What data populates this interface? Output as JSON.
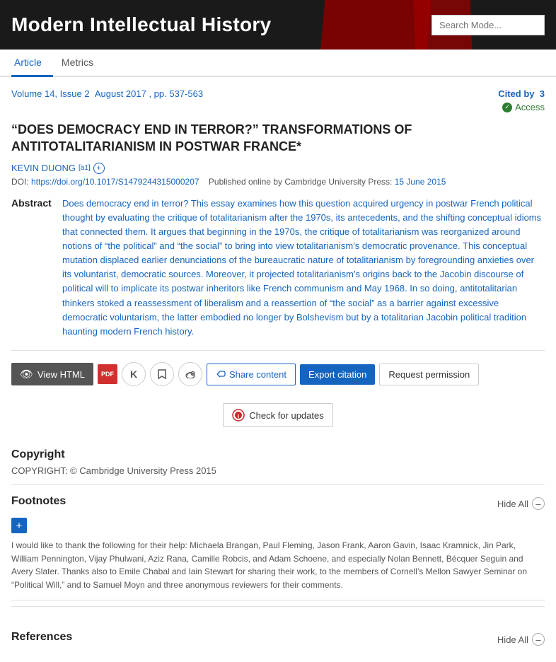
{
  "header": {
    "title": "Modern Intellectual History",
    "search_placeholder": "Search Mode..."
  },
  "tabs": [
    {
      "label": "Article",
      "active": true
    },
    {
      "label": "Metrics",
      "active": false
    }
  ],
  "article": {
    "volume_link": "Volume 14, Issue 2",
    "date_pages": "August 2017 , pp. 537-563",
    "cited_by_label": "Cited by",
    "cited_by_count": "3",
    "access_label": "Access",
    "title": "“DOES DEMOCRACY END IN TERROR?” TRANSFORMATIONS OF ANTITOTALITARIANISM IN POSTWAR FRANCE*",
    "author": "KEVIN DUONG",
    "author_superscript": "[a1]",
    "doi_label": "DOI:",
    "doi_url": "https://doi.org/10.1017/S1479244315000207",
    "published_label": "Published online by Cambridge University Press:",
    "published_date": "15 June 2015",
    "abstract_label": "Abstract",
    "abstract_text": "Does democracy end in terror? This essay examines how this question acquired urgency in postwar French political thought by evaluating the critique of totalitarianism after the 1970s, its antecedents, and the shifting conceptual idioms that connected them. It argues that beginning in the 1970s, the critique of totalitarianism was reorganized around notions of “the political” and “the social” to bring into view totalitarianism’s democratic provenance. This conceptual mutation displaced earlier denunciations of the bureaucratic nature of totalitarianism by foregrounding anxieties over its voluntarist, democratic sources. Moreover, it projected totalitarianism’s origins back to the Jacobin discourse of political will to implicate its postwar inheritors like French communism and May 1968. In so doing, antitotalitarian thinkers stoked a reassessment of liberalism and a reassertion of “the social” as a barrier against excessive democratic voluntarism, the latter embodied no longer by Bolshevism but by a totalitarian Jacobin political tradition haunting modern French history."
  },
  "buttons": {
    "view_html": "View HTML",
    "share": "Share content",
    "export": "Export citation",
    "request": "Request permission",
    "check_updates": "Check for updates"
  },
  "copyright": {
    "title": "Copyright",
    "content": "COPYRIGHT: © Cambridge University Press 2015"
  },
  "footnotes": {
    "title": "Footnotes",
    "hide_all": "Hide All",
    "text": "I would like to thank the following for their help: Michaela Brangan, Paul Fleming, Jason Frank, Aaron Gavin, Isaac Kramnick, Jin Park, William Pennington, Vijay Phulwani, Aziz Rana, Camille Robcis, and Adam Schoene, and especially Nolan Bennett, Bécquer Seguin and Avery Slater. Thanks also to Emile Chabal and Iain Stewart for sharing their work, to the members of Cornell’s Mellon Sawyer Seminar on “Political Will,” and to Samuel Moyn and three anonymous reviewers for their comments."
  },
  "references": {
    "title": "References",
    "hide_all": "Hide All"
  }
}
